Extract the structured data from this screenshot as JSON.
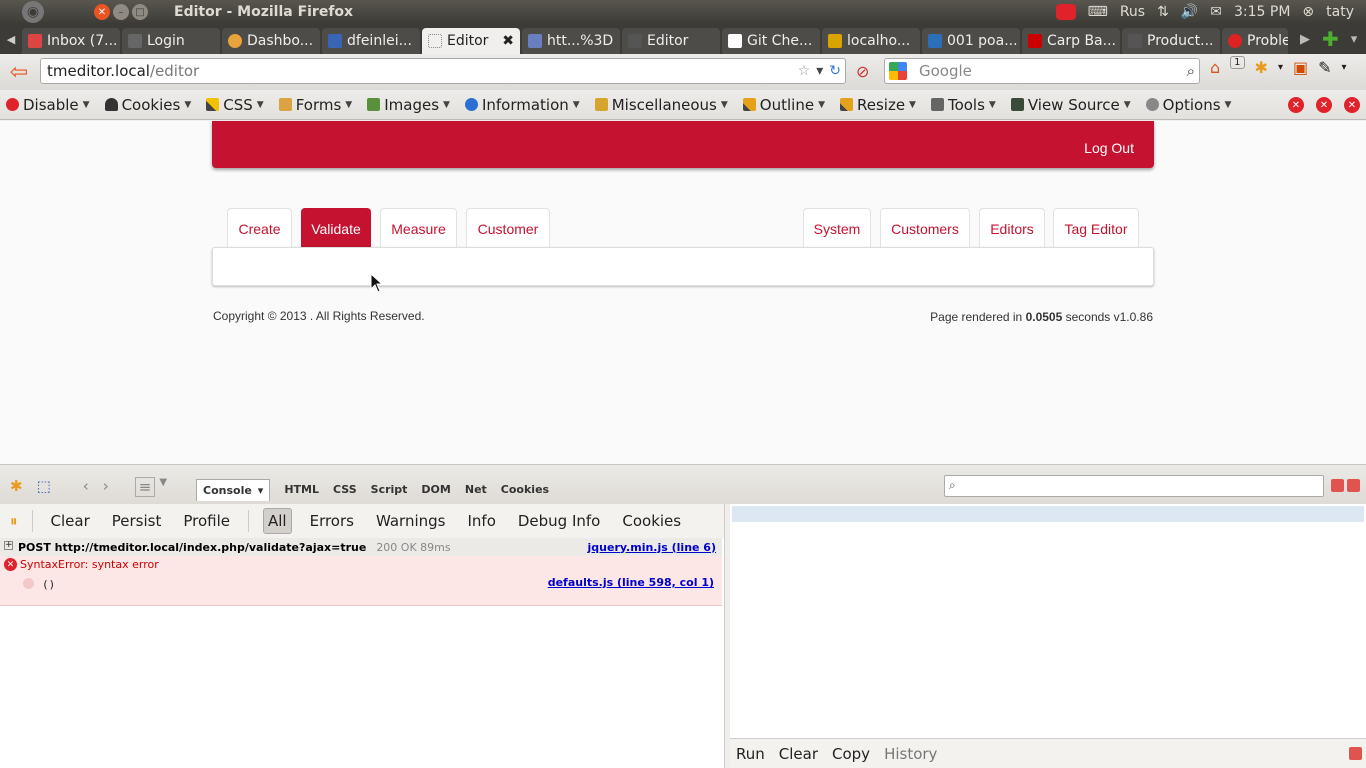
{
  "window": {
    "title": "Editor - Mozilla Firefox"
  },
  "tray": {
    "lang": "Rus",
    "time": "3:15 PM",
    "user": "taty"
  },
  "tabs": [
    {
      "label": "Inbox (7...",
      "color": "#d44"
    },
    {
      "label": "Login",
      "color": "#666"
    },
    {
      "label": "Dashbo...",
      "color": "#e8a33c"
    },
    {
      "label": "dfeinlei...",
      "color": "#3a64b5"
    },
    {
      "label": "Editor",
      "color": "#ddd",
      "active": true
    },
    {
      "label": "htt...%3D",
      "color": "#6a7fbf"
    },
    {
      "label": "Editor",
      "color": "#555"
    },
    {
      "label": "Git Che...",
      "color": "#fff"
    },
    {
      "label": "localho...",
      "color": "#d9a400"
    },
    {
      "label": "001 poa...",
      "color": "#2a6fb7"
    },
    {
      "label": "Carp Ba...",
      "color": "#c00"
    },
    {
      "label": "Product...",
      "color": "#555"
    },
    {
      "label": "Proble...",
      "color": "#d22"
    }
  ],
  "nav": {
    "url_host": "tmeditor.local",
    "url_path": "/editor",
    "search_placeholder": "Google",
    "badge": "1"
  },
  "devbar": [
    "Disable",
    "Cookies",
    "CSS",
    "Forms",
    "Images",
    "Information",
    "Miscellaneous",
    "Outline",
    "Resize",
    "Tools",
    "View Source",
    "Options"
  ],
  "page": {
    "logout": "Log Out",
    "tabs_left": [
      "Create",
      "Validate",
      "Measure",
      "Customer"
    ],
    "tabs_right": [
      "System",
      "Customers",
      "Editors",
      "Tag Editor"
    ],
    "active_tab": "Validate",
    "copyright": "Copyright © 2013 . All Rights Reserved.",
    "render_prefix": "Page rendered in ",
    "render_time": "0.0505",
    "render_suffix": " seconds v1.0.86"
  },
  "firebug": {
    "panels": [
      "Console",
      "HTML",
      "CSS",
      "Script",
      "DOM",
      "Net",
      "Cookies"
    ],
    "filters": [
      "Clear",
      "Persist",
      "Profile",
      "All",
      "Errors",
      "Warnings",
      "Info",
      "Debug Info",
      "Cookies"
    ],
    "active_filter": "All",
    "request": {
      "method": "POST http://tmeditor.local/index.php/validate?ajax=true",
      "status": "200 OK 89ms",
      "file": "jquery.min.js (line 6)"
    },
    "error": {
      "message": "SyntaxError: syntax error",
      "code": "()",
      "file": "defaults.js (line 598, col 1)"
    },
    "cmd": [
      "Run",
      "Clear",
      "Copy",
      "History"
    ]
  }
}
